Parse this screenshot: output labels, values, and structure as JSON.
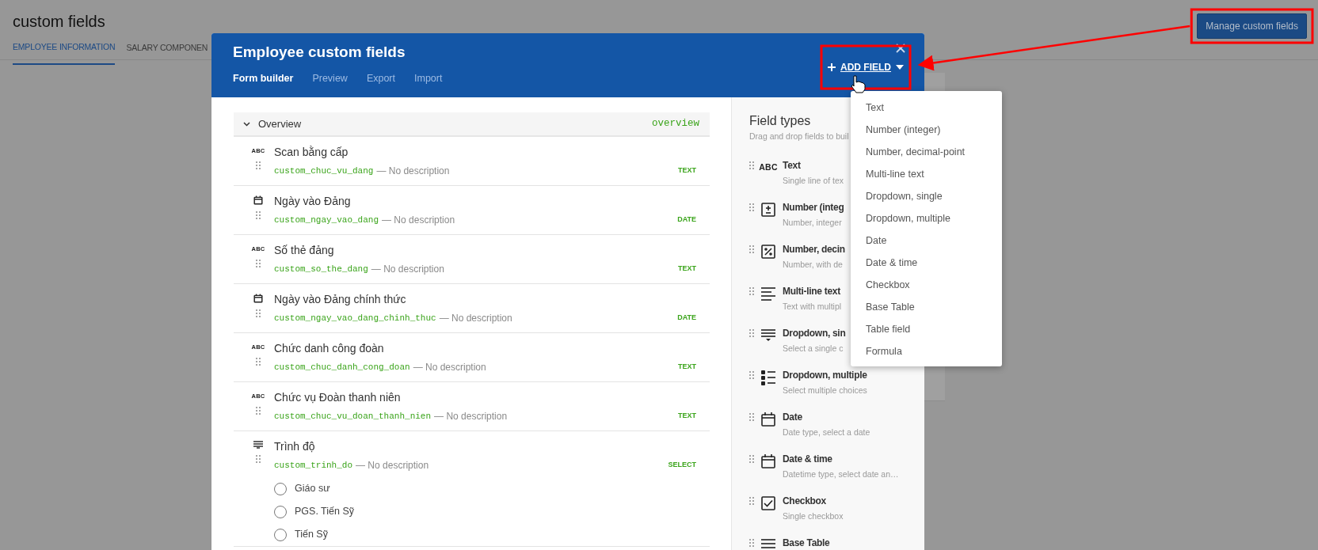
{
  "page": {
    "title": "custom fields",
    "tabs": [
      {
        "label": "EMPLOYEE INFORMATION",
        "selected": true
      },
      {
        "label": "SALARY COMPONEN",
        "selected": false
      }
    ],
    "manage_button": "Manage custom fields"
  },
  "modal": {
    "title": "Employee custom fields",
    "tabs": [
      {
        "label": "Form builder",
        "selected": true
      },
      {
        "label": "Preview",
        "selected": false
      },
      {
        "label": "Export",
        "selected": false
      },
      {
        "label": "Import",
        "selected": false
      }
    ],
    "add_field": "ADD FIELD",
    "section": {
      "title": "Overview",
      "code": "overview",
      "expanded": true
    },
    "fields": [
      {
        "kind": "text",
        "icon_text": "ABC",
        "name": "Scan bằng cấp",
        "code": "custom_chuc_vu_dang",
        "description": "— No description",
        "type": "TEXT"
      },
      {
        "kind": "date",
        "name": "Ngày vào Đảng",
        "code": "custom_ngay_vao_dang",
        "description": "— No description",
        "type": "DATE"
      },
      {
        "kind": "text",
        "icon_text": "ABC",
        "name": "Số thẻ đảng",
        "code": "custom_so_the_dang",
        "description": "— No description",
        "type": "TEXT"
      },
      {
        "kind": "date",
        "name": "Ngày vào Đảng chính thức",
        "code": "custom_ngay_vao_dang_chinh_thuc",
        "description": "— No description",
        "type": "DATE"
      },
      {
        "kind": "text",
        "icon_text": "ABC",
        "name": "Chức danh công đoàn",
        "code": "custom_chuc_danh_cong_doan",
        "description": "— No description",
        "type": "TEXT"
      },
      {
        "kind": "text",
        "icon_text": "ABC",
        "name": "Chức vụ Đoàn thanh niên",
        "code": "custom_chuc_vu_doan_thanh_nien",
        "description": "— No description",
        "type": "TEXT"
      },
      {
        "kind": "select",
        "name": "Trình độ",
        "code": "custom_trinh_do",
        "description": "— No description",
        "type": "SELECT",
        "options": [
          {
            "label": "Giáo sư",
            "selected": false
          },
          {
            "label": "PGS. Tiến Sỹ",
            "selected": false
          },
          {
            "label": "Tiến Sỹ",
            "selected": false
          }
        ]
      }
    ],
    "field_types": {
      "title": "Field types",
      "subtitle": "Drag and drop fields to buil",
      "items": [
        {
          "kind": "text",
          "icon_text": "ABC",
          "name": "Text",
          "description": "Single line of tex"
        },
        {
          "kind": "integer",
          "name": "Number (integ",
          "description": "Number, integer"
        },
        {
          "kind": "decimal",
          "name": "Number, decin",
          "description": "Number, with de"
        },
        {
          "kind": "multiline",
          "name": "Multi-line text",
          "description": "Text with multipl"
        },
        {
          "kind": "single",
          "name": "Dropdown, sin",
          "description": "Select a single c"
        },
        {
          "kind": "multiple",
          "name": "Dropdown, multiple",
          "description": "Select multiple choices"
        },
        {
          "kind": "date",
          "name": "Date",
          "description": "Date type, select a date"
        },
        {
          "kind": "date",
          "name": "Date & time",
          "description": "Datetime type, select date an…"
        },
        {
          "kind": "checkbox",
          "name": "Checkbox",
          "description": "Single checkbox"
        },
        {
          "kind": "table",
          "name": "Base Table"
        }
      ]
    }
  },
  "add_menu": {
    "items": [
      "Text",
      "Number (integer)",
      "Number, decimal-point",
      "Multi-line text",
      "Dropdown, single",
      "Dropdown, multiple",
      "Date",
      "Date & time",
      "Checkbox",
      "Base Table",
      "Table field",
      "Formula"
    ]
  }
}
